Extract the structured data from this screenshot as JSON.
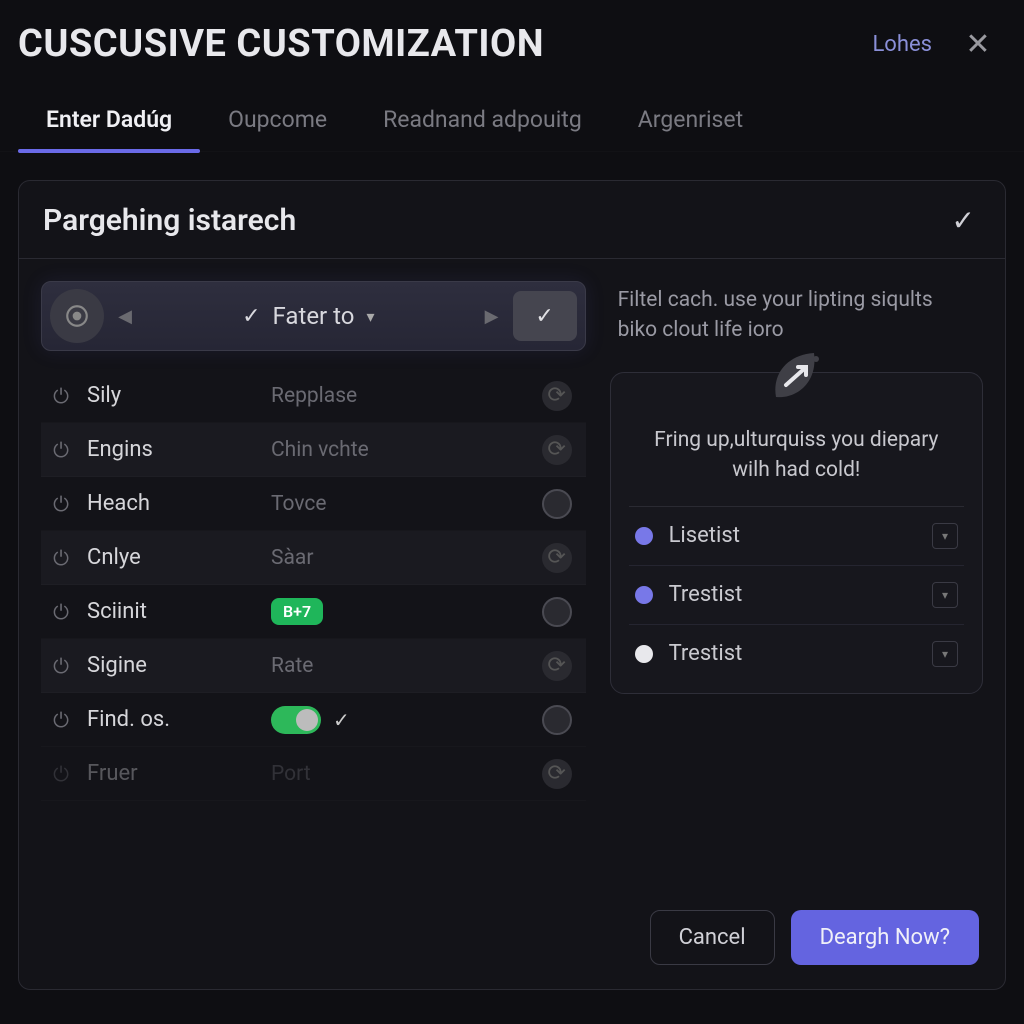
{
  "header": {
    "title": "CUSCUSIVE CUSTOMIZATION",
    "link": "Lohes"
  },
  "tabs": [
    {
      "label": "Enter Dadúg",
      "active": true
    },
    {
      "label": "Oupcome",
      "active": false
    },
    {
      "label": "Readnand adpouitg",
      "active": false
    },
    {
      "label": "Argenriset",
      "active": false
    }
  ],
  "panel": {
    "title": "Pargehing istarech",
    "toolbar_label": "Fater to",
    "rows": [
      {
        "label": "Sily",
        "value": "Repplase",
        "end": "refresh",
        "alt": false
      },
      {
        "label": "Engins",
        "value": "Chin vchte",
        "end": "refresh",
        "alt": true
      },
      {
        "label": "Heach",
        "value": "Tovce",
        "end": "circle",
        "alt": false
      },
      {
        "label": "Cnlye",
        "value": "Sàar",
        "end": "refresh",
        "alt": true
      },
      {
        "label": "Sciinit",
        "value": "",
        "badge": "B+7",
        "end": "circle",
        "alt": false
      },
      {
        "label": "Sigine",
        "value": "Rate",
        "end": "refresh",
        "alt": true
      },
      {
        "label": "Find. os.",
        "value": "",
        "toggle": true,
        "end": "circle",
        "alt": false
      },
      {
        "label": "Fruer",
        "value": "Port",
        "end": "refresh",
        "alt": false,
        "faded": true
      }
    ]
  },
  "side": {
    "helper": "Filtel cach. use your lipting siqults biko clout life ioro",
    "card_text": "Fring up,ulturquiss you diepary wilh had cold!",
    "options": [
      {
        "label": "Lisetist",
        "dot": "purple"
      },
      {
        "label": "Trestist",
        "dot": "purple"
      },
      {
        "label": "Trestist",
        "dot": "white"
      }
    ]
  },
  "footer": {
    "cancel": "Cancel",
    "primary": "Deargh Now?"
  }
}
